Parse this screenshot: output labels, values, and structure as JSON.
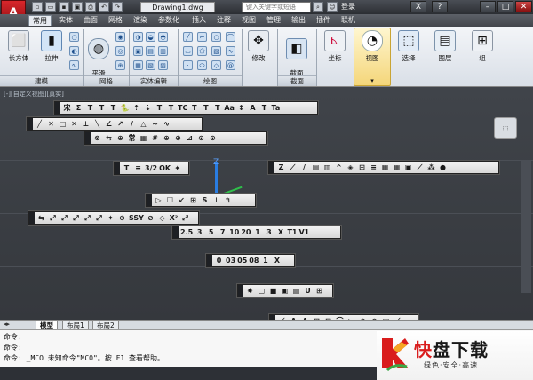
{
  "window": {
    "doc_title": "Drawing1.dwg",
    "search_placeholder": "键入关键字或短语",
    "login": "登录",
    "logo_letter": "A"
  },
  "tabs": [
    "常用",
    "实体",
    "曲面",
    "网格",
    "渲染",
    "参数化",
    "插入",
    "注释",
    "视图",
    "管理",
    "输出",
    "插件",
    "联机"
  ],
  "ribbon": {
    "box": "长方体",
    "extrude": "拉伸",
    "smooth": "平滑\n对象",
    "edit": "修改",
    "section": "截面\n平面",
    "coords": "坐标",
    "view": "视图",
    "select": "选择",
    "layers": "图层",
    "group": "组",
    "groups": [
      "建模",
      "网格",
      "实体编辑",
      "绘图",
      "截面"
    ]
  },
  "viewport_label": "[-][自定义视图][真实]",
  "toolbars": {
    "t1": [
      "宋",
      "Σ",
      "T",
      "T",
      "T",
      "🐍",
      "⇡",
      "⇣",
      "T",
      "T",
      "TC",
      "T",
      "T",
      "T",
      "Aa",
      "↕",
      "A",
      "T",
      "Ta"
    ],
    "t2": [
      "╱",
      "✕",
      "□",
      "✕",
      "⊥",
      "╲",
      "∠",
      "↗",
      "∕",
      "△",
      "∼",
      "∿"
    ],
    "t3": [
      "⊗",
      "⇆",
      "⊕",
      "常",
      "▦",
      "#",
      "⊕",
      "⊕",
      "⊿",
      "⊙",
      "⊙"
    ],
    "t4": [
      "T",
      "≡",
      "3/2",
      "OK",
      "✦"
    ],
    "t5": [
      "Z",
      "⟋",
      "/",
      "▤",
      "▥",
      "^",
      "◈",
      "⊞",
      "≡",
      "▦",
      "▦",
      "▣",
      "⟋",
      "⁂",
      "●"
    ],
    "t6": [
      "▷",
      "☐",
      "↙",
      "⊞",
      "S",
      "⊥",
      "↰"
    ],
    "t7": [
      "⇆",
      "⤢",
      "⤢",
      "⤢",
      "⤢",
      "⤢",
      "✦",
      "⊙",
      "SSY",
      "⊘",
      "◇",
      "X²",
      "⤢"
    ],
    "t8": [
      "2.5",
      "3",
      "5",
      "7",
      "10",
      "20",
      "1",
      "3",
      "X",
      "T1",
      "V1"
    ],
    "t9": [
      "0",
      "03",
      "05",
      "08",
      "1",
      "X"
    ],
    "t10": [
      "✸",
      "▢",
      "■",
      "▣",
      "▤",
      "U",
      "⊞"
    ],
    "t11": [
      "⟋",
      "A",
      "A",
      "⊞",
      "⊟",
      "⌒",
      "◣",
      "⊙",
      "⊙",
      "▤",
      "⟋"
    ],
    "t12": [
      "🐴",
      "👤"
    ]
  },
  "layout_tabs": [
    "模型",
    "布局1",
    "布局2"
  ],
  "command_lines": [
    "命令:",
    "命令:",
    "命令: _MCO 未知命令\"MCO\"。按 F1 查看帮助。"
  ],
  "watermark": {
    "logo": "K",
    "brand": "快盘下载",
    "slogan": "绿色·安全·高速"
  },
  "colors": {
    "accent": "#f4d67a",
    "logo_red": "#d8262b",
    "viewport": "#3a3d42"
  }
}
